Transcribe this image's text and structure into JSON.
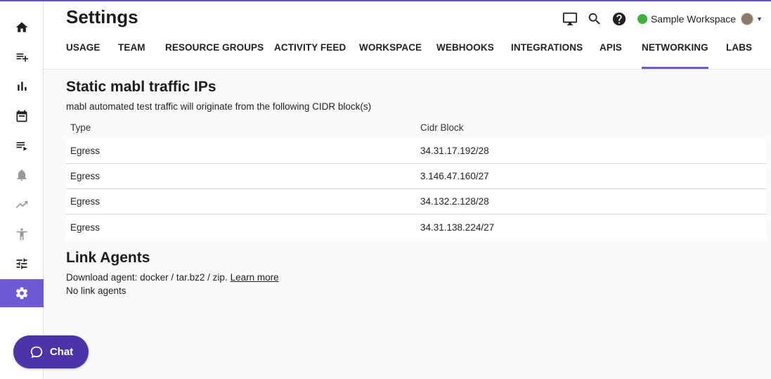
{
  "app": {
    "page_title": "Settings",
    "accent_color": "#6c5ad6"
  },
  "sidebar": {
    "items": [
      {
        "icon": "home-icon"
      },
      {
        "icon": "playlist-add-icon"
      },
      {
        "icon": "bar-chart-icon"
      },
      {
        "icon": "calendar-icon"
      },
      {
        "icon": "playlist-play-icon"
      },
      {
        "icon": "bell-icon"
      },
      {
        "icon": "trending-up-icon"
      },
      {
        "icon": "accessibility-icon"
      },
      {
        "icon": "tune-icon"
      },
      {
        "icon": "gear-icon",
        "active": true
      }
    ]
  },
  "header": {
    "tools": [
      "monitor-icon",
      "search-icon",
      "help-icon"
    ],
    "workspace": {
      "name": "Sample Workspace",
      "status_color": "#3db33d"
    }
  },
  "tabs": [
    {
      "label": "USAGE"
    },
    {
      "label": "TEAM"
    },
    {
      "label": "RESOURCE GROUPS"
    },
    {
      "label": "ACTIVITY FEED"
    },
    {
      "label": "WORKSPACE"
    },
    {
      "label": "WEBHOOKS"
    },
    {
      "label": "INTEGRATIONS"
    },
    {
      "label": "APIS"
    },
    {
      "label": "NETWORKING",
      "active": true
    },
    {
      "label": "LABS"
    }
  ],
  "static_ips": {
    "heading": "Static mabl traffic IPs",
    "description": "mabl automated test traffic will originate from the following CIDR block(s)",
    "columns": [
      "Type",
      "Cidr Block"
    ],
    "rows": [
      {
        "type": "Egress",
        "cidr": "34.31.17.192/28"
      },
      {
        "type": "Egress",
        "cidr": "3.146.47.160/27"
      },
      {
        "type": "Egress",
        "cidr": "34.132.2.128/28"
      },
      {
        "type": "Egress",
        "cidr": "34.31.138.224/27"
      }
    ]
  },
  "link_agents": {
    "heading": "Link Agents",
    "download_text": "Download agent: docker / tar.bz2 / zip.",
    "learn_more": "Learn more",
    "empty_text": "No link agents"
  },
  "chat": {
    "label": "Chat"
  }
}
